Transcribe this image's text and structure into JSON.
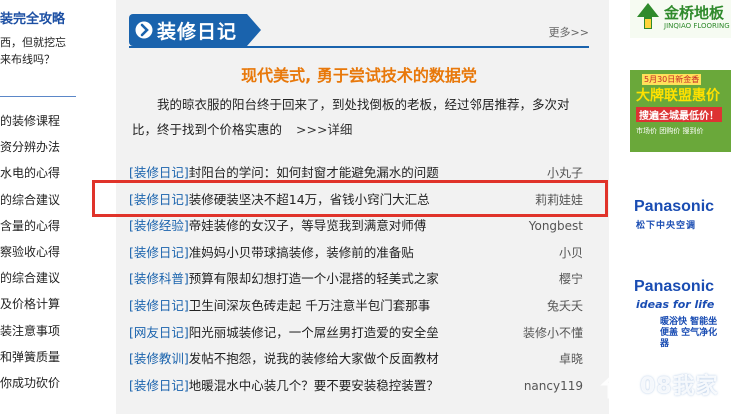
{
  "left": {
    "headline": "装完全攻略",
    "sub_lines": [
      "西，但就挖忘",
      "来布线吗？"
    ],
    "list": [
      "的装修课程",
      "资分辨办法",
      "水电的心得",
      "的综合建议",
      "含量的心得",
      "察验收心得",
      "的综合建议",
      "及价格计算",
      "装注意事项",
      "和弹簧质量",
      "你成功砍价"
    ]
  },
  "main": {
    "section_title": "装修日记",
    "more_label": "更多>>",
    "feature": {
      "title": "现代美式, 勇于尝试技术的数据党",
      "desc": "我的晾衣服的阳台终于回来了，到处找倒板的老板，经过邻居推荐，多次对比，终于找到个价格实惠的",
      "detail_label": ">>>详细"
    },
    "articles": [
      {
        "category": "[装修日记]",
        "title": "封阳台的学问：如何封窗才能避免漏水的问题",
        "author": "小丸子"
      },
      {
        "category": "[装修日记]",
        "title": "装修硬装坚决不超14万，省钱小窍门大汇总",
        "author": "莉莉娃娃"
      },
      {
        "category": "[装修经验]",
        "title": "帝娃装修的女汉子，等导览我到满意对师傅",
        "author": "Yongbest"
      },
      {
        "category": "[装修日记]",
        "title": "准妈妈小贝带球搞装修，装修前的准备贴",
        "author": "小贝"
      },
      {
        "category": "[装修科普]",
        "title": "预算有限却幻想打造一个小混搭的轻美式之家",
        "author": "樱宁"
      },
      {
        "category": "[装修日记]",
        "title": "卫生间深灰色砖走起  千万注意半包门套那事",
        "author": "兔夭夭"
      },
      {
        "category": "[网友日记]",
        "title": "阳光丽城装修记，一个屌丝男打造爱的安全垒",
        "author": "装修小不懂"
      },
      {
        "category": "[装修教训]",
        "title": "发帖不抱怨，说我的装修给大家做个反面教材",
        "author": "卓晓"
      },
      {
        "category": "[装修日记]",
        "title": "地暖混水中心装几个？要不要安装稳控装置？",
        "author": "nancy119"
      }
    ]
  },
  "ads": {
    "ad1": {
      "brand": "金桥地板",
      "sub": "JINQIAO FLOORING"
    },
    "ad2": {
      "line1": "5月30日新金香",
      "line2": "大牌联盟惠价日",
      "line3": "搜遍全城最低价！",
      "line4": "市场价  团购价  搜到价"
    },
    "ad3": {
      "brand": "Panasonic",
      "sub": "松下中央空调"
    },
    "ad4": {
      "brand": "Panasonic",
      "tagline": "ideas for life",
      "sub": "暖浴快 智能坐便盖 空气净化器"
    }
  },
  "watermark": {
    "text": "08我家"
  },
  "colors": {
    "accent": "#1a63ad",
    "highlight": "#e0332a",
    "title_orange": "#e8780a"
  }
}
